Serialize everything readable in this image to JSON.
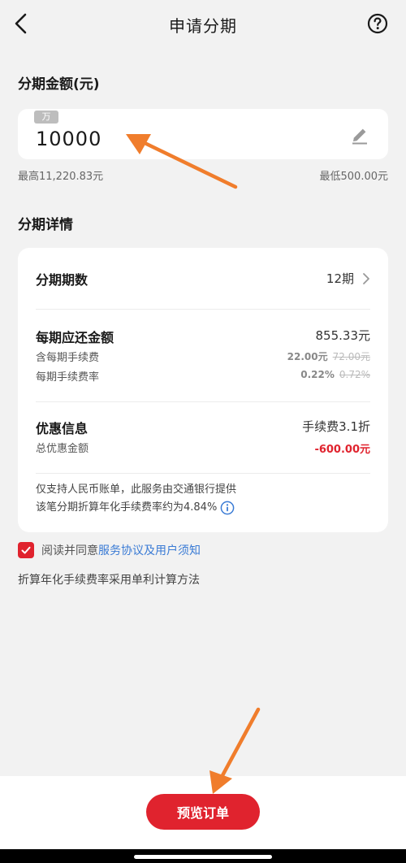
{
  "header": {
    "title": "申请分期"
  },
  "amount": {
    "section_title": "分期金额(元)",
    "unit_tag": "万",
    "value": "10000",
    "max_label": "最高11,220.83元",
    "min_label": "最低500.00元"
  },
  "detail": {
    "section_title": "分期详情",
    "periods": {
      "label": "分期期数",
      "value": "12期"
    },
    "per_period": {
      "label": "每期应还金额",
      "value": "855.33元",
      "fee_label": "含每期手续费",
      "fee_value": "22.00元",
      "fee_original": "72.00元",
      "rate_label": "每期手续费率",
      "rate_value": "0.22%",
      "rate_original": "0.72%"
    },
    "promo": {
      "label": "优惠信息",
      "value": "手续费3.1折",
      "total_label": "总优惠金额",
      "total_value": "-600.00元"
    },
    "note_line1": "仅支持人民币账单，此服务由交通银行提供",
    "note_line2": "该笔分期折算年化手续费率约为4.84%"
  },
  "agreement": {
    "prefix": "阅读并同意",
    "link": "服务协议及用户须知",
    "checked": true
  },
  "method_note": "折算年化手续费率采用单利计算方法",
  "submit_label": "预览订单",
  "colors": {
    "accent": "#e0232e",
    "link": "#3a7bd5",
    "annotation_arrow": "#f07d2c"
  }
}
